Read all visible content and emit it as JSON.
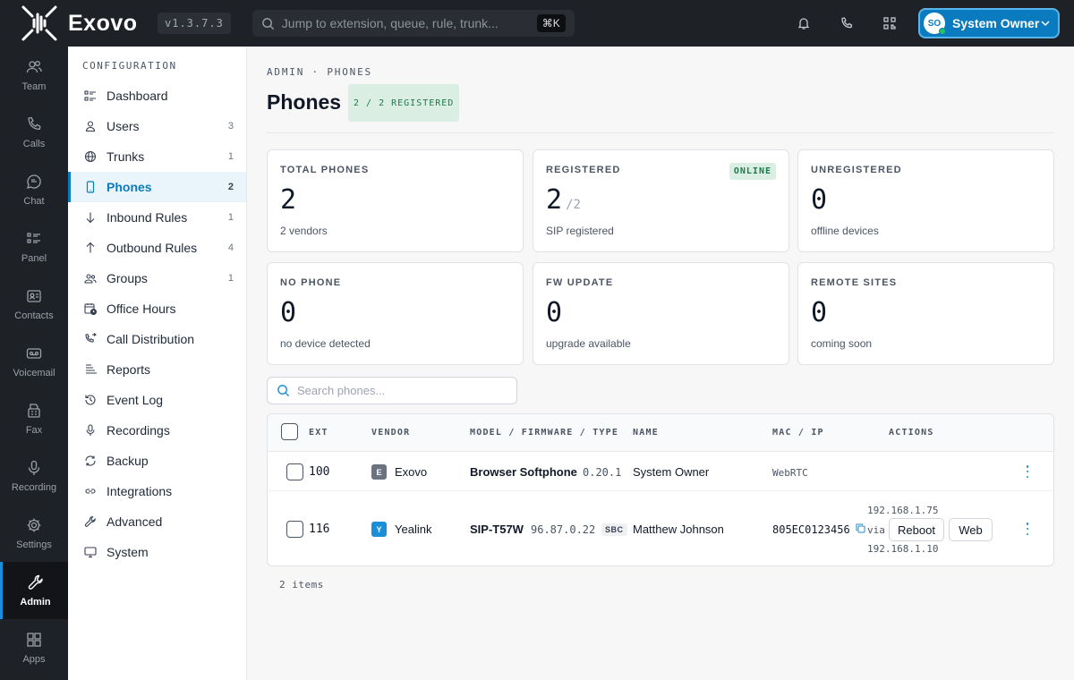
{
  "app": {
    "name": "Exovo",
    "version": "v1.3.7.3",
    "search_placeholder": "Jump to extension, queue, rule, trunk...",
    "search_shortcut": "⌘K",
    "user": {
      "initials": "SO",
      "name": "System Owner"
    }
  },
  "rail": [
    {
      "label": "Team",
      "icon": "team-icon"
    },
    {
      "label": "Calls",
      "icon": "phone-icon"
    },
    {
      "label": "Chat",
      "icon": "chat-icon"
    },
    {
      "label": "Panel",
      "icon": "panel-icon"
    },
    {
      "label": "Contacts",
      "icon": "contacts-icon"
    },
    {
      "label": "Voicemail",
      "icon": "voicemail-icon"
    },
    {
      "label": "Fax",
      "icon": "fax-icon"
    },
    {
      "label": "Recording",
      "icon": "mic-icon"
    },
    {
      "label": "Settings",
      "icon": "gear-icon"
    },
    {
      "label": "Admin",
      "icon": "wrench-icon",
      "active": true
    },
    {
      "label": "Apps",
      "icon": "apps-icon"
    }
  ],
  "config": {
    "title": "CONFIGURATION",
    "items": [
      {
        "label": "Dashboard",
        "count": "",
        "icon": "dashboard-icon"
      },
      {
        "label": "Users",
        "count": "3",
        "icon": "user-icon"
      },
      {
        "label": "Trunks",
        "count": "1",
        "icon": "globe-icon"
      },
      {
        "label": "Phones",
        "count": "2",
        "icon": "smartphone-icon",
        "active": true
      },
      {
        "label": "Inbound Rules",
        "count": "1",
        "icon": "arrow-down-icon"
      },
      {
        "label": "Outbound Rules",
        "count": "4",
        "icon": "arrow-up-icon"
      },
      {
        "label": "Groups",
        "count": "1",
        "icon": "group-icon"
      },
      {
        "label": "Office Hours",
        "count": "",
        "icon": "calendar-clock-icon"
      },
      {
        "label": "Call Distribution",
        "count": "",
        "icon": "phone-forward-icon"
      },
      {
        "label": "Reports",
        "count": "",
        "icon": "reports-icon"
      },
      {
        "label": "Event Log",
        "count": "",
        "icon": "history-icon"
      },
      {
        "label": "Recordings",
        "count": "",
        "icon": "mic-icon"
      },
      {
        "label": "Backup",
        "count": "",
        "icon": "refresh-icon"
      },
      {
        "label": "Integrations",
        "count": "",
        "icon": "link-icon"
      },
      {
        "label": "Advanced",
        "count": "",
        "icon": "wrench-icon"
      },
      {
        "label": "System",
        "count": "",
        "icon": "monitor-icon"
      }
    ]
  },
  "page": {
    "breadcrumb": "ADMIN · PHONES",
    "title": "Phones",
    "registered_badge": "2 / 2 REGISTERED"
  },
  "stats": {
    "total": {
      "label": "TOTAL PHONES",
      "value": "2",
      "sub": "2 vendors"
    },
    "registered": {
      "label": "REGISTERED",
      "value": "2",
      "of": "/2",
      "sub": "SIP registered",
      "badge": "ONLINE"
    },
    "unregistered": {
      "label": "UNREGISTERED",
      "value": "0",
      "sub": "offline devices"
    },
    "no_phone": {
      "label": "NO PHONE",
      "value": "0",
      "sub": "no device detected"
    },
    "fw_update": {
      "label": "FW UPDATE",
      "value": "0",
      "sub": "upgrade available"
    },
    "remote": {
      "label": "REMOTE SITES",
      "value": "0",
      "sub": "coming soon"
    }
  },
  "search_phones_placeholder": "Search phones...",
  "table": {
    "headers": {
      "ext": "EXT",
      "vendor": "VENDOR",
      "model": "MODEL / FIRMWARE / TYPE",
      "name": "NAME",
      "mac": "MAC / IP",
      "actions": "ACTIONS"
    },
    "rows": [
      {
        "ext": "100",
        "vendor_initial": "E",
        "vendor": "Exovo",
        "vendor_color": "#6b7280",
        "model": "Browser Softphone",
        "firmware": "0.20.1",
        "type": "",
        "name": "System Owner",
        "mac": "WebRTC"
      },
      {
        "ext": "116",
        "vendor_initial": "Y",
        "vendor": "Yealink",
        "vendor_color": "#1a8fd8",
        "model": "SIP-T57W",
        "firmware": "96.87.0.22",
        "type": "SBC",
        "name": "Matthew Johnson",
        "mac": "805EC0123456",
        "ip": "192.168.1.75",
        "via": "via",
        "ip2": "192.168.1.10",
        "reboot": "Reboot",
        "web": "Web"
      }
    ],
    "footer": "2 items"
  },
  "colors": {
    "accent": "#0b7bc0",
    "online_bg": "#dbeee3",
    "online_text": "#1f7a4a",
    "dark": "#1e2126"
  }
}
